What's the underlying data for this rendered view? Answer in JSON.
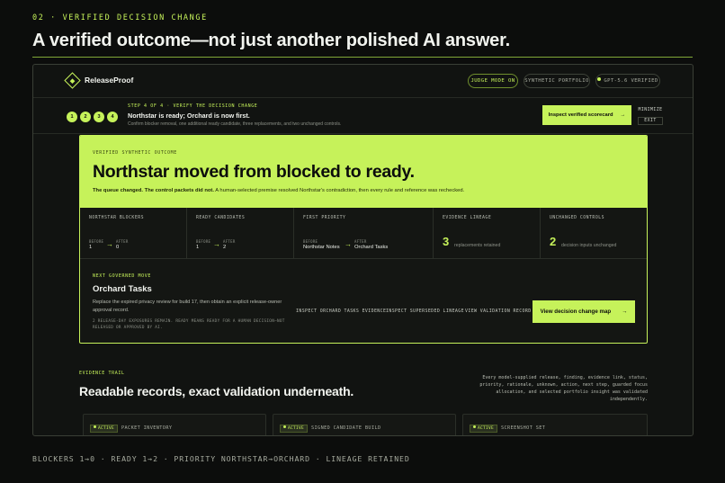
{
  "kicker": "02 · VERIFIED DECISION CHANGE",
  "headline": "A verified outcome—not just another polished AI answer.",
  "app": {
    "logo": "ReleaseProof",
    "pills": {
      "judge": "JUDGE MODE ON",
      "portfolio": "SYNTHETIC PORTFOLIO",
      "model": "GPT-5.6 VERIFIED"
    }
  },
  "stepper": {
    "steps": [
      "1",
      "2",
      "3",
      "4"
    ],
    "label": "STEP 4 OF 4 · VERIFY THE DECISION CHANGE",
    "title": "Northstar is ready; Orchard is now first.",
    "desc": "Confirm blocker removal, one additional ready candidate, three replacements, and two unchanged controls.",
    "cta": "Inspect verified scorecard",
    "minimize": "MINIMIZE",
    "exit": "EXIT"
  },
  "outcome": {
    "kicker": "VERIFIED SYNTHETIC OUTCOME",
    "title": "Northstar moved from blocked to ready.",
    "sub_bold": "The queue changed. The control packets did not.",
    "sub": "A human-selected premise resolved Northstar's contradiction, then every rule and reference was rechecked."
  },
  "metrics": {
    "blockers": {
      "label": "NORTHSTAR BLOCKERS",
      "before_label": "BEFORE",
      "before": "1",
      "after_label": "AFTER",
      "after": "0"
    },
    "ready": {
      "label": "READY CANDIDATES",
      "before_label": "BEFORE",
      "before": "1",
      "after_label": "AFTER",
      "after": "2"
    },
    "priority": {
      "label": "FIRST PRIORITY",
      "before_label": "BEFORE",
      "before": "Northstar Notes",
      "after_label": "AFTER",
      "after": "Orchard Tasks"
    },
    "lineage": {
      "label": "EVIDENCE LINEAGE",
      "value": "3",
      "caption": "replacements retained"
    },
    "controls": {
      "label": "UNCHANGED CONTROLS",
      "value": "2",
      "caption": "decision inputs unchanged"
    }
  },
  "next_move": {
    "label": "NEXT GOVERNED MOVE",
    "title": "Orchard Tasks",
    "desc": "Replace the expired privacy review for build 17, then obtain an explicit release-owner approval record.",
    "note": "2 RELEASE-DAY EXPOSURES REMAIN. READY MEANS READY FOR A HUMAN DECISION—NOT RELEASED OR APPROVED BY AI.",
    "links": [
      "INSPECT ORCHARD TASKS EVIDENCE",
      "INSPECT SUPERSEDED LINEAGE",
      "VIEW VALIDATION RECORD"
    ],
    "cta": "View decision change map"
  },
  "trail": {
    "label": "EVIDENCE TRAIL",
    "title": "Readable records, exact validation underneath.",
    "desc": "Every model-supplied release, finding, evidence link, status, priority, rationale, unknown, action, next step, guarded focus allocation, and selected portfolio insight was validated independently.",
    "tiles": [
      {
        "tag": "ACTIVE",
        "name": "PACKET INVENTORY"
      },
      {
        "tag": "ACTIVE",
        "name": "SIGNED CANDIDATE BUILD"
      },
      {
        "tag": "ACTIVE",
        "name": "SCREENSHOT SET"
      }
    ]
  },
  "footer": "BLOCKERS 1→0 · READY 1→2 · PRIORITY NORTHSTAR→ORCHARD · LINEAGE RETAINED",
  "colors": {
    "accent": "#c6f25a",
    "background": "#0c0d0c",
    "panel": "#111311"
  },
  "icons": {
    "logo": "diamond-logo-icon",
    "arrow": "arrow-right-icon",
    "status": "status-dot-icon"
  }
}
